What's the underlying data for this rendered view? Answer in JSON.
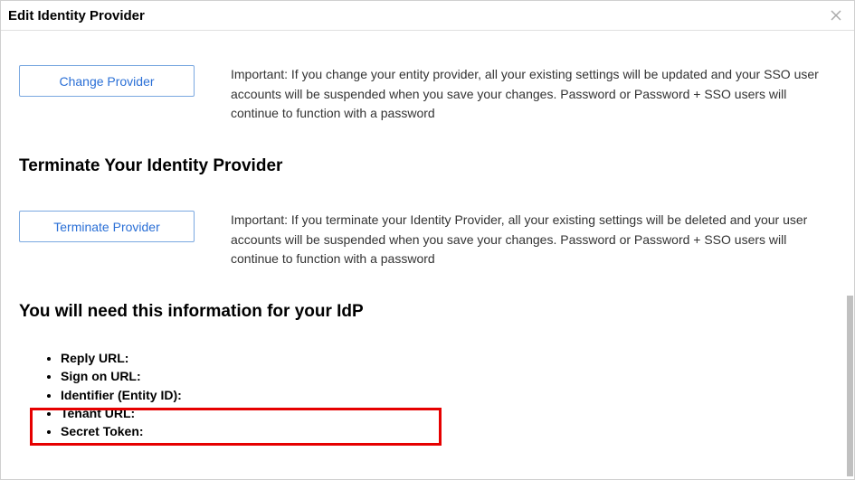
{
  "dialog": {
    "title": "Edit Identity Provider"
  },
  "change": {
    "button_label": "Change Provider",
    "important": "Important: If you change your entity provider, all your existing settings will be updated and your SSO user accounts will be suspended when you save your changes. Password or Password + SSO users will continue to function with a password"
  },
  "terminate": {
    "heading": "Terminate Your Identity Provider",
    "button_label": "Terminate Provider",
    "important": "Important: If you terminate your Identity Provider, all your existing settings will be deleted and your user accounts will be suspended when you save your changes. Password or Password + SSO users will continue to function with a password"
  },
  "idp_info": {
    "heading": "You will need this information for your IdP",
    "items": [
      "Reply URL:",
      "Sign on URL:",
      "Identifier (Entity ID):",
      "Tenant URL:",
      "Secret Token:"
    ]
  }
}
